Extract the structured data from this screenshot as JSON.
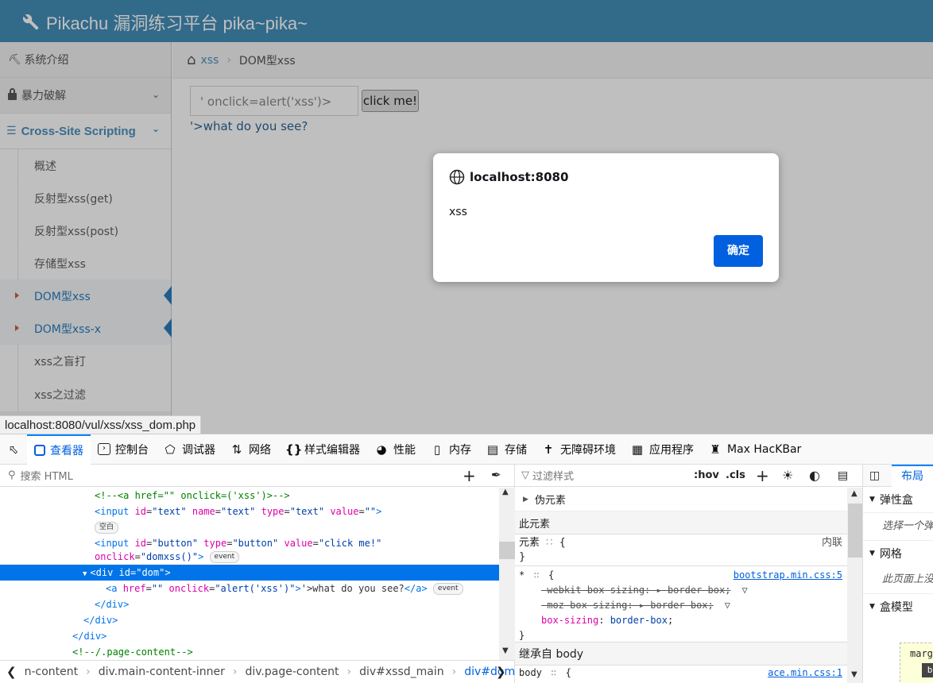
{
  "app": {
    "title": "Pikachu 漏洞练习平台 pika~pika~",
    "sidebar": {
      "item_intro": "系统介绍",
      "item_brute": "暴力破解",
      "item_xss": "Cross-Site Scripting",
      "sub": [
        "概述",
        "反射型xss(get)",
        "反射型xss(post)",
        "存储型xss",
        "DOM型xss",
        "DOM型xss-x",
        "xss之盲打",
        "xss之过滤"
      ]
    },
    "breadcrumb": {
      "root": "xss",
      "current": "DOM型xss"
    },
    "input_value": "' onclick=alert('xss')>",
    "button_label": "click me!",
    "result_link": "'>what do you see?",
    "status_url": "localhost:8080/vul/xss/xss_dom.php"
  },
  "dialog": {
    "origin": "localhost:8080",
    "message": "xss",
    "ok": "确定",
    "ok_color": "#0060df"
  },
  "devtools": {
    "tabs": [
      "查看器",
      "控制台",
      "调试器",
      "网络",
      "样式编辑器",
      "性能",
      "内存",
      "存储",
      "无障碍环境",
      "应用程序",
      "Max HacKBar"
    ],
    "search_placeholder": "搜索 HTML",
    "markup": {
      "l1": "<!--<a href=\"\" onclick=('xss')>-->",
      "l2_tag1": "<input ",
      "l2_a1": "id",
      "l2_v1": "\"text\"",
      "l2_a2": "name",
      "l2_v2": "\"text\"",
      "l2_a3": "type",
      "l2_v3": "\"text\"",
      "l2_a4": "value",
      "l2_v4": "\"\"",
      "l2_end": ">",
      "badge_empty": "空白",
      "l4_tag": "<input ",
      "l4_a1": "id",
      "l4_v1": "\"button\"",
      "l4_a2": "type",
      "l4_v2": "\"button\"",
      "l4_a3": "value",
      "l4_v3": "\"click me!\"",
      "l5_a1": "onclick",
      "l5_v1": "\"domxss()\"",
      "l5_end": ">",
      "badge_event": "event",
      "sel_tag": "<div ",
      "sel_a": "id",
      "sel_v": "\"dom\"",
      "sel_end": ">",
      "a_open": "<a ",
      "a_a1": "href",
      "a_v1": "\"\"",
      "a_a2": "onclick",
      "a_v2": "\"alert('xss')\"",
      "a_mid": ">",
      "a_text": "'>what do you see?",
      "a_close": "</a>",
      "div_close": "</div>",
      "cmt2": "<!--/.page-content-->"
    },
    "crumbs": [
      "n-content",
      "div.main-content-inner",
      "div.page-content",
      "div#xssd_main",
      "div#dom"
    ],
    "rules": {
      "filter_placeholder": "过滤样式",
      "hov": ":hov",
      "cls": ".cls",
      "pseudo": "伪元素",
      "this_element": "此元素",
      "element_label": "元素",
      "brace_open": "{",
      "brace_close": "}",
      "inline": "内联",
      "star": "*",
      "src1": "bootstrap.min.css:5",
      "d1_prop": "-webkit-box-sizing",
      "d1_val": "border-box",
      "d2_prop": "-moz-box-sizing",
      "d2_val": "border-box",
      "d3_prop": "box-sizing",
      "d3_val": "border-box",
      "inherited": "继承自 body",
      "body_sel": "body",
      "src2": "ace.min.css:1"
    },
    "layout": {
      "tab": "布局",
      "flexbox": "弹性盒",
      "flexbox_hint": "选择一个弹",
      "grid": "网格",
      "grid_hint": "此页面上没",
      "boxmodel": "盒模型",
      "margin": "marg",
      "b": "b"
    }
  }
}
